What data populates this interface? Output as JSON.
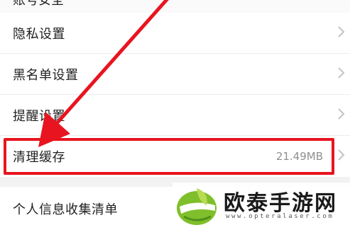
{
  "settings": {
    "partial_item": {
      "label": "账号安全"
    },
    "items": [
      {
        "label": "隐私设置",
        "value": ""
      },
      {
        "label": "黑名单设置",
        "value": ""
      },
      {
        "label": "提醒设置",
        "value": ""
      },
      {
        "label": "清理缓存",
        "value": "21.49MB"
      },
      {
        "label": "个人信息收集清单",
        "value": ""
      }
    ]
  },
  "annotation": {
    "highlight_color": "#e8141f",
    "arrow_color": "#e8141f"
  },
  "watermark": {
    "title": "欧泰手游网",
    "url": "www.opteralaser.com",
    "logo": "leaf-logo"
  }
}
